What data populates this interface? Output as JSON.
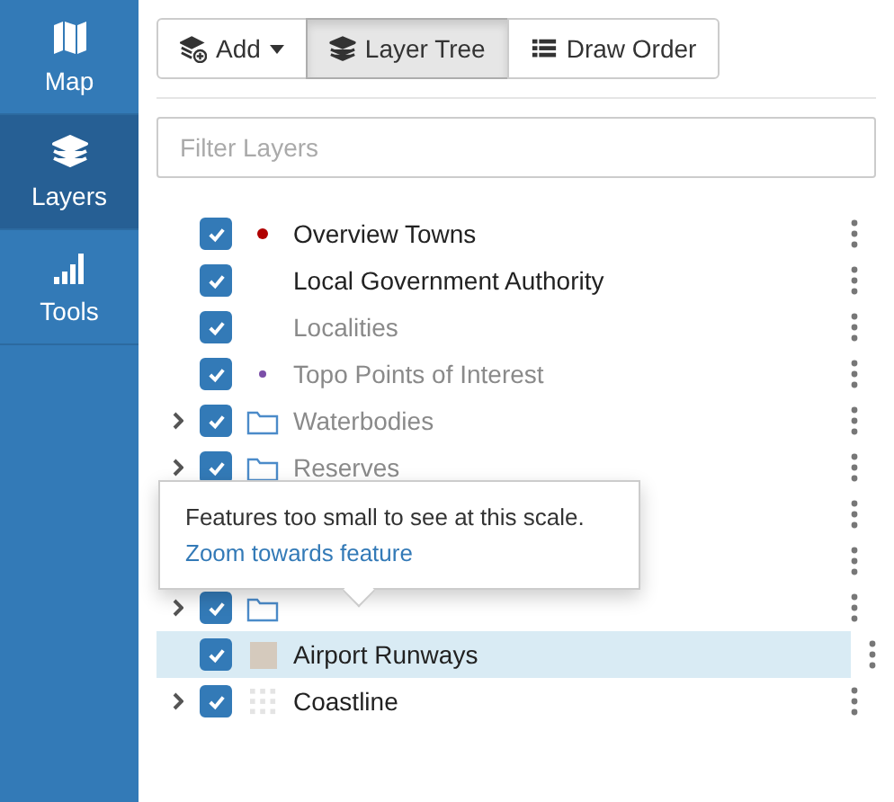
{
  "sidebar": {
    "items": [
      {
        "label": "Map",
        "selected": false
      },
      {
        "label": "Layers",
        "selected": true
      },
      {
        "label": "Tools",
        "selected": false
      }
    ]
  },
  "toolbar": {
    "buttons": [
      {
        "label": "Add",
        "selected": false
      },
      {
        "label": "Layer Tree",
        "selected": true
      },
      {
        "label": "Draw Order",
        "selected": false
      }
    ]
  },
  "filter": {
    "placeholder": "Filter Layers"
  },
  "layers": [
    {
      "label": "Overview Towns",
      "checked": true,
      "expandable": false,
      "dimmed": false,
      "selected": false,
      "kind": "dot",
      "color": "#b00000"
    },
    {
      "label": "Local Government Authority",
      "checked": true,
      "expandable": false,
      "dimmed": false,
      "selected": false,
      "kind": "none"
    },
    {
      "label": "Localities",
      "checked": true,
      "expandable": false,
      "dimmed": true,
      "selected": false,
      "kind": "none"
    },
    {
      "label": "Topo Points of Interest",
      "checked": true,
      "expandable": false,
      "dimmed": true,
      "selected": false,
      "kind": "smalldot",
      "color": "#7b4fa8"
    },
    {
      "label": "Waterbodies",
      "checked": true,
      "expandable": true,
      "dimmed": true,
      "selected": false,
      "kind": "folder"
    },
    {
      "label": "Reserves",
      "checked": true,
      "expandable": true,
      "dimmed": true,
      "selected": false,
      "kind": "folder"
    },
    {
      "selected": false,
      "kind": "none"
    },
    {
      "selected": false,
      "kind": "none"
    },
    {
      "checked": true,
      "expandable": true,
      "selected": false,
      "kind": "folder"
    },
    {
      "label": "Airport Runways",
      "checked": true,
      "expandable": false,
      "dimmed": false,
      "selected": true,
      "kind": "swatch",
      "color": "#d5cabd"
    },
    {
      "label": "Coastline",
      "checked": true,
      "expandable": true,
      "dimmed": false,
      "selected": false,
      "kind": "grid"
    }
  ],
  "tooltip": {
    "text": "Features too small to see at this scale.",
    "link": "Zoom towards feature"
  }
}
